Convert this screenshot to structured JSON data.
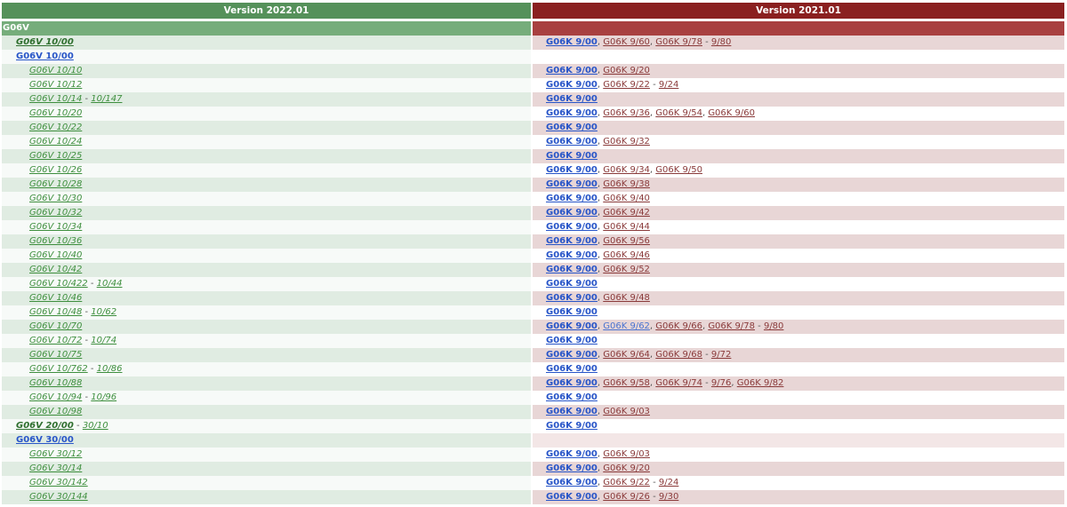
{
  "header": {
    "left_title": "Version 2022.01",
    "right_title": "Version 2021.01"
  },
  "subheader": {
    "left_label": "G06V",
    "right_label": ""
  },
  "colors": {
    "left_header": "#55915a",
    "right_header": "#8a2020",
    "left_row_alt": "#e0ece2",
    "right_row_alt": "#e8d6d6"
  },
  "rows": [
    {
      "level": 1,
      "left": [
        {
          "t": "G06V 10/00",
          "s": "gb"
        }
      ],
      "right": [
        {
          "t": "G06K 9/00",
          "s": "rb"
        },
        {
          "t": ", ",
          "s": "sep"
        },
        {
          "t": "G06K 9/60",
          "s": "r"
        },
        {
          "t": ", ",
          "s": "sep"
        },
        {
          "t": "G06K 9/78",
          "s": "r"
        },
        {
          "t": " - ",
          "s": "sep"
        },
        {
          "t": "9/80",
          "s": "r"
        }
      ]
    },
    {
      "level": 1,
      "left": [
        {
          "t": "G06V 10/00",
          "s": "b"
        }
      ],
      "right": []
    },
    {
      "level": 2,
      "left": [
        {
          "t": "G06V 10/10",
          "s": "g"
        }
      ],
      "right": [
        {
          "t": "G06K 9/00",
          "s": "rb"
        },
        {
          "t": ", ",
          "s": "sep"
        },
        {
          "t": "G06K 9/20",
          "s": "r"
        }
      ]
    },
    {
      "level": 2,
      "left": [
        {
          "t": "G06V 10/12",
          "s": "g"
        }
      ],
      "right": [
        {
          "t": "G06K 9/00",
          "s": "rb"
        },
        {
          "t": ", ",
          "s": "sep"
        },
        {
          "t": "G06K 9/22",
          "s": "r"
        },
        {
          "t": " - ",
          "s": "sep"
        },
        {
          "t": "9/24",
          "s": "r"
        }
      ]
    },
    {
      "level": 2,
      "left": [
        {
          "t": "G06V 10/14",
          "s": "g"
        },
        {
          "t": " - ",
          "s": "sep"
        },
        {
          "t": "10/147",
          "s": "g"
        }
      ],
      "right": [
        {
          "t": "G06K 9/00",
          "s": "rb"
        }
      ]
    },
    {
      "level": 2,
      "left": [
        {
          "t": "G06V 10/20",
          "s": "g"
        }
      ],
      "right": [
        {
          "t": "G06K 9/00",
          "s": "rb"
        },
        {
          "t": ", ",
          "s": "sep"
        },
        {
          "t": "G06K 9/36",
          "s": "r"
        },
        {
          "t": ", ",
          "s": "sep"
        },
        {
          "t": "G06K 9/54",
          "s": "r"
        },
        {
          "t": ", ",
          "s": "sep"
        },
        {
          "t": "G06K 9/60",
          "s": "r"
        }
      ]
    },
    {
      "level": 2,
      "left": [
        {
          "t": "G06V 10/22",
          "s": "g"
        }
      ],
      "right": [
        {
          "t": "G06K 9/00",
          "s": "rb"
        }
      ]
    },
    {
      "level": 2,
      "left": [
        {
          "t": "G06V 10/24",
          "s": "g"
        }
      ],
      "right": [
        {
          "t": "G06K 9/00",
          "s": "rb"
        },
        {
          "t": ", ",
          "s": "sep"
        },
        {
          "t": "G06K 9/32",
          "s": "r"
        }
      ]
    },
    {
      "level": 2,
      "left": [
        {
          "t": "G06V 10/25",
          "s": "g"
        }
      ],
      "right": [
        {
          "t": "G06K 9/00",
          "s": "rb"
        }
      ]
    },
    {
      "level": 2,
      "left": [
        {
          "t": "G06V 10/26",
          "s": "g"
        }
      ],
      "right": [
        {
          "t": "G06K 9/00",
          "s": "rb"
        },
        {
          "t": ", ",
          "s": "sep"
        },
        {
          "t": "G06K 9/34",
          "s": "r"
        },
        {
          "t": ", ",
          "s": "sep"
        },
        {
          "t": "G06K 9/50",
          "s": "r"
        }
      ]
    },
    {
      "level": 2,
      "left": [
        {
          "t": "G06V 10/28",
          "s": "g"
        }
      ],
      "right": [
        {
          "t": "G06K 9/00",
          "s": "rb"
        },
        {
          "t": ", ",
          "s": "sep"
        },
        {
          "t": "G06K 9/38",
          "s": "r"
        }
      ]
    },
    {
      "level": 2,
      "left": [
        {
          "t": "G06V 10/30",
          "s": "g"
        }
      ],
      "right": [
        {
          "t": "G06K 9/00",
          "s": "rb"
        },
        {
          "t": ", ",
          "s": "sep"
        },
        {
          "t": "G06K 9/40",
          "s": "r"
        }
      ]
    },
    {
      "level": 2,
      "left": [
        {
          "t": "G06V 10/32",
          "s": "g"
        }
      ],
      "right": [
        {
          "t": "G06K 9/00",
          "s": "rb"
        },
        {
          "t": ", ",
          "s": "sep"
        },
        {
          "t": "G06K 9/42",
          "s": "r"
        }
      ]
    },
    {
      "level": 2,
      "left": [
        {
          "t": "G06V 10/34",
          "s": "g"
        }
      ],
      "right": [
        {
          "t": "G06K 9/00",
          "s": "rb"
        },
        {
          "t": ", ",
          "s": "sep"
        },
        {
          "t": "G06K 9/44",
          "s": "r"
        }
      ]
    },
    {
      "level": 2,
      "left": [
        {
          "t": "G06V 10/36",
          "s": "g"
        }
      ],
      "right": [
        {
          "t": "G06K 9/00",
          "s": "rb"
        },
        {
          "t": ", ",
          "s": "sep"
        },
        {
          "t": "G06K 9/56",
          "s": "r"
        }
      ]
    },
    {
      "level": 2,
      "left": [
        {
          "t": "G06V 10/40",
          "s": "g"
        }
      ],
      "right": [
        {
          "t": "G06K 9/00",
          "s": "rb"
        },
        {
          "t": ", ",
          "s": "sep"
        },
        {
          "t": "G06K 9/46",
          "s": "r"
        }
      ]
    },
    {
      "level": 2,
      "left": [
        {
          "t": "G06V 10/42",
          "s": "g"
        }
      ],
      "right": [
        {
          "t": "G06K 9/00",
          "s": "rb"
        },
        {
          "t": ", ",
          "s": "sep"
        },
        {
          "t": "G06K 9/52",
          "s": "r"
        }
      ]
    },
    {
      "level": 2,
      "left": [
        {
          "t": "G06V 10/422",
          "s": "g"
        },
        {
          "t": " - ",
          "s": "sep"
        },
        {
          "t": "10/44",
          "s": "g"
        }
      ],
      "right": [
        {
          "t": "G06K 9/00",
          "s": "rb"
        }
      ]
    },
    {
      "level": 2,
      "left": [
        {
          "t": "G06V 10/46",
          "s": "g"
        }
      ],
      "right": [
        {
          "t": "G06K 9/00",
          "s": "rb"
        },
        {
          "t": ", ",
          "s": "sep"
        },
        {
          "t": "G06K 9/48",
          "s": "r"
        }
      ]
    },
    {
      "level": 2,
      "left": [
        {
          "t": "G06V 10/48",
          "s": "g"
        },
        {
          "t": " - ",
          "s": "sep"
        },
        {
          "t": "10/62",
          "s": "g"
        }
      ],
      "right": [
        {
          "t": "G06K 9/00",
          "s": "rb"
        }
      ]
    },
    {
      "level": 2,
      "left": [
        {
          "t": "G06V 10/70",
          "s": "g"
        }
      ],
      "right": [
        {
          "t": "G06K 9/00",
          "s": "rb"
        },
        {
          "t": ", ",
          "s": "sep"
        },
        {
          "t": "G06K 9/62",
          "s": "rl"
        },
        {
          "t": ", ",
          "s": "sep"
        },
        {
          "t": "G06K 9/66",
          "s": "r"
        },
        {
          "t": ", ",
          "s": "sep"
        },
        {
          "t": "G06K 9/78",
          "s": "r"
        },
        {
          "t": " - ",
          "s": "sep"
        },
        {
          "t": "9/80",
          "s": "r"
        }
      ]
    },
    {
      "level": 2,
      "left": [
        {
          "t": "G06V 10/72",
          "s": "g"
        },
        {
          "t": " - ",
          "s": "sep"
        },
        {
          "t": "10/74",
          "s": "g"
        }
      ],
      "right": [
        {
          "t": "G06K 9/00",
          "s": "rb"
        }
      ]
    },
    {
      "level": 2,
      "left": [
        {
          "t": "G06V 10/75",
          "s": "g"
        }
      ],
      "right": [
        {
          "t": "G06K 9/00",
          "s": "rb"
        },
        {
          "t": ", ",
          "s": "sep"
        },
        {
          "t": "G06K 9/64",
          "s": "r"
        },
        {
          "t": ", ",
          "s": "sep"
        },
        {
          "t": "G06K 9/68",
          "s": "r"
        },
        {
          "t": " - ",
          "s": "sep"
        },
        {
          "t": "9/72",
          "s": "r"
        }
      ]
    },
    {
      "level": 2,
      "left": [
        {
          "t": "G06V 10/762",
          "s": "g"
        },
        {
          "t": " - ",
          "s": "sep"
        },
        {
          "t": "10/86",
          "s": "g"
        }
      ],
      "right": [
        {
          "t": "G06K 9/00",
          "s": "rb"
        }
      ]
    },
    {
      "level": 2,
      "left": [
        {
          "t": "G06V 10/88",
          "s": "g"
        }
      ],
      "right": [
        {
          "t": "G06K 9/00",
          "s": "rb"
        },
        {
          "t": ", ",
          "s": "sep"
        },
        {
          "t": "G06K 9/58",
          "s": "r"
        },
        {
          "t": ", ",
          "s": "sep"
        },
        {
          "t": "G06K 9/74",
          "s": "r"
        },
        {
          "t": " - ",
          "s": "sep"
        },
        {
          "t": "9/76",
          "s": "r"
        },
        {
          "t": ", ",
          "s": "sep"
        },
        {
          "t": "G06K 9/82",
          "s": "r"
        }
      ]
    },
    {
      "level": 2,
      "left": [
        {
          "t": "G06V 10/94",
          "s": "g"
        },
        {
          "t": " - ",
          "s": "sep"
        },
        {
          "t": "10/96",
          "s": "g"
        }
      ],
      "right": [
        {
          "t": "G06K 9/00",
          "s": "rb"
        }
      ]
    },
    {
      "level": 2,
      "left": [
        {
          "t": "G06V 10/98",
          "s": "g"
        }
      ],
      "right": [
        {
          "t": "G06K 9/00",
          "s": "rb"
        },
        {
          "t": ", ",
          "s": "sep"
        },
        {
          "t": "G06K 9/03",
          "s": "r"
        }
      ]
    },
    {
      "level": 1,
      "left": [
        {
          "t": "G06V 20/00",
          "s": "gb"
        },
        {
          "t": " - ",
          "s": "sep"
        },
        {
          "t": "30/10",
          "s": "g"
        }
      ],
      "right": [
        {
          "t": "G06K 9/00",
          "s": "rb"
        }
      ]
    },
    {
      "level": 1,
      "left": [
        {
          "t": "G06V 30/00",
          "s": "b"
        }
      ],
      "right": [],
      "blank": true
    },
    {
      "level": 2,
      "left": [
        {
          "t": "G06V 30/12",
          "s": "g"
        }
      ],
      "right": [
        {
          "t": "G06K 9/00",
          "s": "rb"
        },
        {
          "t": ", ",
          "s": "sep"
        },
        {
          "t": "G06K 9/03",
          "s": "r"
        }
      ]
    },
    {
      "level": 2,
      "left": [
        {
          "t": "G06V 30/14",
          "s": "g"
        }
      ],
      "right": [
        {
          "t": "G06K 9/00",
          "s": "rb"
        },
        {
          "t": ", ",
          "s": "sep"
        },
        {
          "t": "G06K 9/20",
          "s": "r"
        }
      ]
    },
    {
      "level": 2,
      "left": [
        {
          "t": "G06V 30/142",
          "s": "g"
        }
      ],
      "right": [
        {
          "t": "G06K 9/00",
          "s": "rb"
        },
        {
          "t": ", ",
          "s": "sep"
        },
        {
          "t": "G06K 9/22",
          "s": "r"
        },
        {
          "t": " - ",
          "s": "sep"
        },
        {
          "t": "9/24",
          "s": "r"
        }
      ]
    },
    {
      "level": 2,
      "left": [
        {
          "t": "G06V 30/144",
          "s": "g"
        }
      ],
      "right": [
        {
          "t": "G06K 9/00",
          "s": "rb"
        },
        {
          "t": ", ",
          "s": "sep"
        },
        {
          "t": "G06K 9/26",
          "s": "r"
        },
        {
          "t": " - ",
          "s": "sep"
        },
        {
          "t": "9/30",
          "s": "r"
        }
      ]
    }
  ]
}
